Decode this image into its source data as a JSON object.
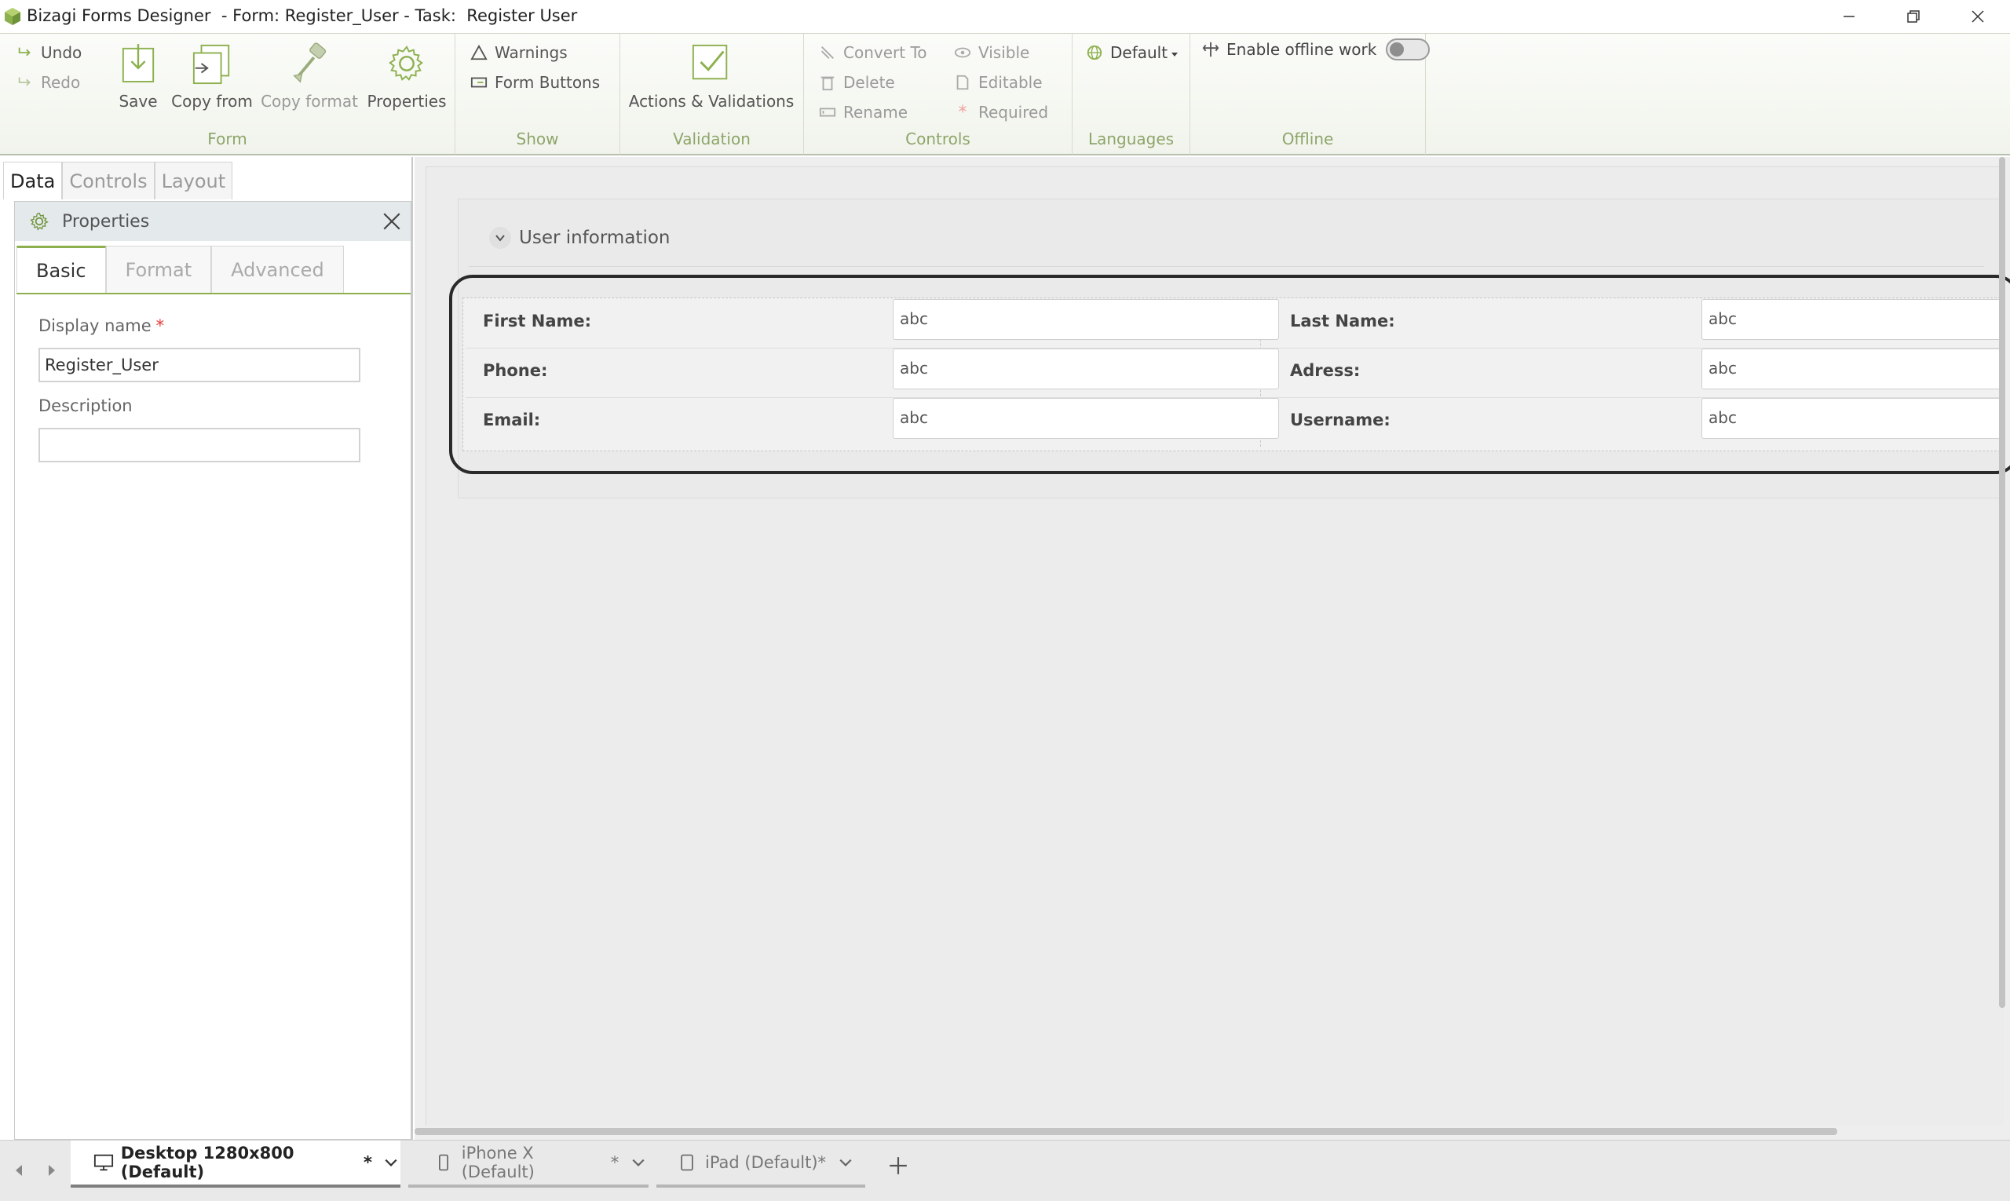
{
  "window": {
    "title": "Bizagi Forms Designer  - Form: Register_User - Task:  Register User"
  },
  "ribbon": {
    "form": {
      "label": "Form",
      "undo": "Undo",
      "redo": "Redo",
      "save": "Save",
      "copy_from": "Copy from",
      "copy_format": "Copy format",
      "properties": "Properties"
    },
    "show": {
      "label": "Show",
      "warnings": "Warnings",
      "form_buttons": "Form Buttons"
    },
    "validation": {
      "label": "Validation",
      "actions": "Actions & Validations"
    },
    "controls": {
      "label": "Controls",
      "convert_to": "Convert To",
      "delete": "Delete",
      "rename": "Rename",
      "visible": "Visible",
      "editable": "Editable",
      "required": "Required"
    },
    "languages": {
      "label": "Languages",
      "selected": "Default"
    },
    "offline": {
      "label": "Offline",
      "enable": "Enable offline work",
      "enabled": false
    }
  },
  "left_panel": {
    "tabs": [
      "Data",
      "Controls",
      "Layout"
    ],
    "properties": {
      "title": "Properties",
      "tabs": [
        "Basic",
        "Format",
        "Advanced"
      ],
      "display_name_label": "Display name",
      "required_mark": "*",
      "display_name_value": "Register_User",
      "description_label": "Description",
      "description_value": ""
    }
  },
  "form": {
    "group_title": "User information",
    "fields": [
      {
        "label": "First Name:",
        "value": "abc"
      },
      {
        "label": "Last Name:",
        "value": "abc"
      },
      {
        "label": "Phone:",
        "value": "abc"
      },
      {
        "label": "Adress:",
        "value": "abc"
      },
      {
        "label": "Email:",
        "value": "abc"
      },
      {
        "label": "Username:",
        "value": "abc"
      }
    ]
  },
  "device_tabs": [
    {
      "label": "Desktop 1280x800 (Default)",
      "modified": " *"
    },
    {
      "label": "iPhone X (Default)",
      "modified": " *"
    },
    {
      "label": "iPad (Default)",
      "modified": " *"
    }
  ],
  "colors": {
    "accent": "#8db04e",
    "group_label": "#8ea56a",
    "required": "#e53935"
  }
}
